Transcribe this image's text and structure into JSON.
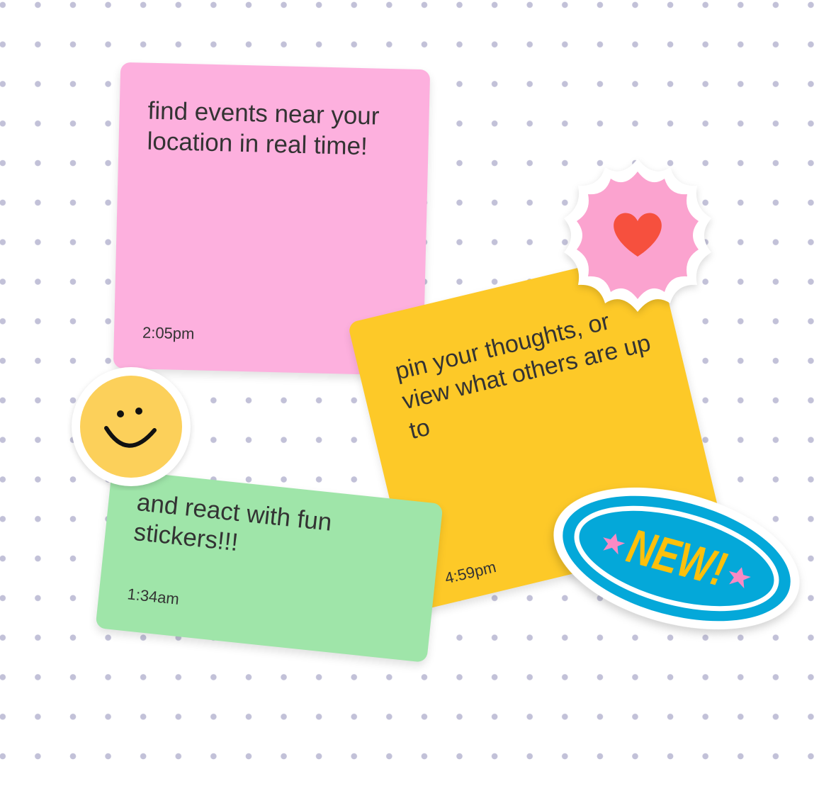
{
  "notes": [
    {
      "text": "find events near your location in real time!",
      "time": "2:05pm",
      "color": "#fdb0de"
    },
    {
      "text": "pin your thoughts, or view what others are up to",
      "time": "4:59pm",
      "color": "#fdc928"
    },
    {
      "text": "and react with fun stickers!!!",
      "time": "1:34am",
      "color": "#9fe5a9"
    }
  ],
  "stickers": {
    "new_label": "NEW!",
    "heart": "heart-icon",
    "smiley": "smiley-icon"
  }
}
